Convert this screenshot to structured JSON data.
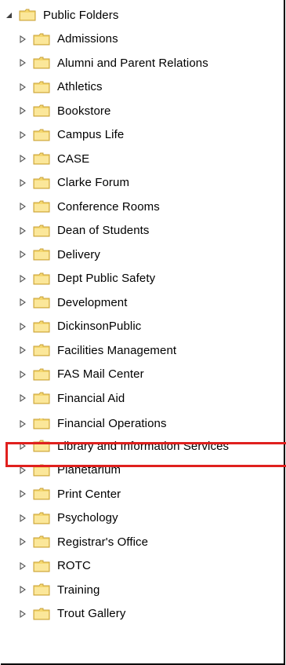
{
  "tree": {
    "root": {
      "label": "Public Folders",
      "expanded": true
    },
    "children": [
      {
        "label": "Admissions"
      },
      {
        "label": "Alumni and Parent Relations"
      },
      {
        "label": "Athletics"
      },
      {
        "label": "Bookstore"
      },
      {
        "label": "Campus Life"
      },
      {
        "label": "CASE"
      },
      {
        "label": "Clarke Forum"
      },
      {
        "label": "Conference Rooms"
      },
      {
        "label": "Dean of Students"
      },
      {
        "label": "Delivery"
      },
      {
        "label": "Dept Public Safety"
      },
      {
        "label": "Development"
      },
      {
        "label": "DickinsonPublic"
      },
      {
        "label": "Facilities Management"
      },
      {
        "label": "FAS Mail Center"
      },
      {
        "label": "Financial Aid"
      },
      {
        "label": "Financial Operations",
        "partially_hidden": true
      },
      {
        "label": "Library and Information Services",
        "highlighted": true
      },
      {
        "label": "Planetarium"
      },
      {
        "label": "Print Center"
      },
      {
        "label": "Psychology"
      },
      {
        "label": "Registrar's Office"
      },
      {
        "label": "ROTC"
      },
      {
        "label": "Training"
      },
      {
        "label": "Trout Gallery"
      }
    ]
  },
  "icons": {
    "expanded": "triangle-down-icon",
    "collapsed": "triangle-right-icon",
    "folder": "folder-icon"
  },
  "colors": {
    "highlight_border": "#e0201e",
    "folder_fill": "#f5d76e",
    "folder_stroke": "#c8a23a"
  }
}
